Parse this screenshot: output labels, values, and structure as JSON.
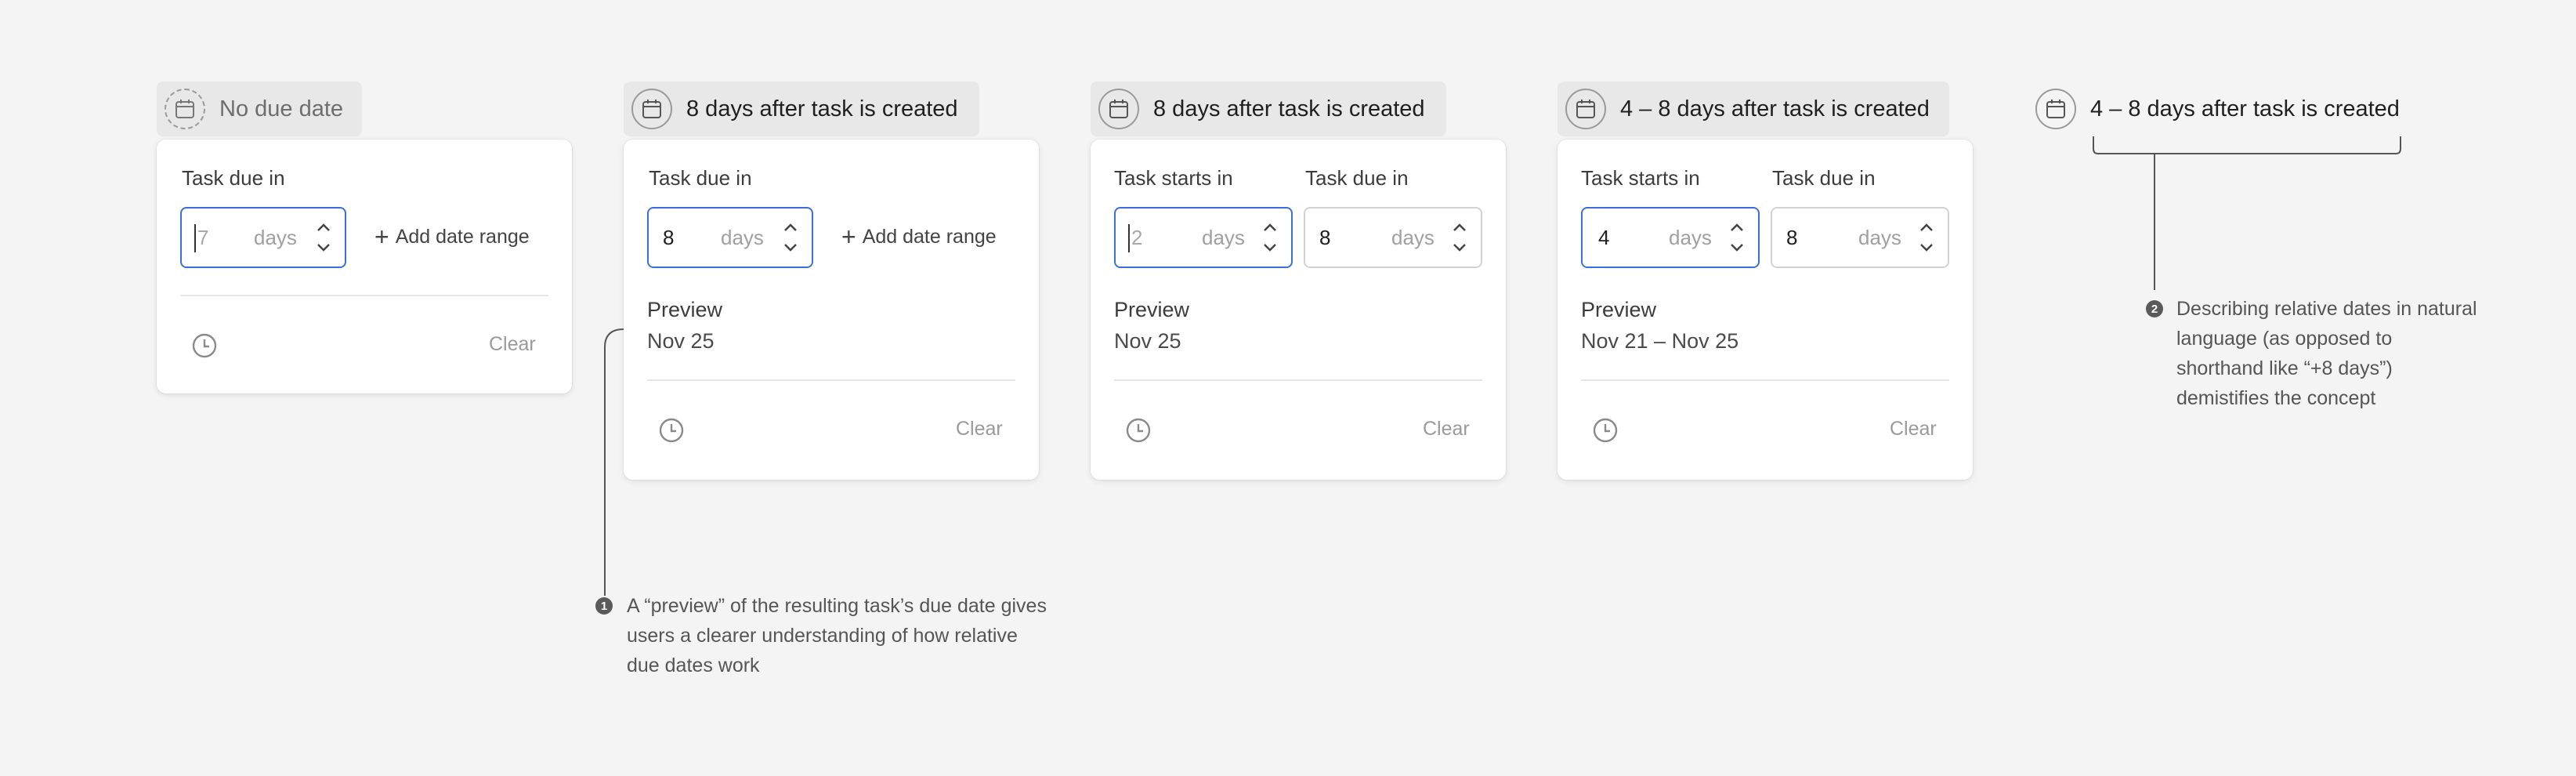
{
  "chips": [
    {
      "text": "No due date"
    },
    {
      "text": "8 days after task is created"
    },
    {
      "text": "8 days after task is created"
    },
    {
      "text": "4 – 8 days after task is created"
    },
    {
      "text": "4 – 8 days after task is created"
    }
  ],
  "card1": {
    "due_label": "Task due in",
    "due_value": "7",
    "unit": "days",
    "add_range": "Add date range",
    "clear": "Clear"
  },
  "card2": {
    "due_label": "Task due in",
    "due_value": "8",
    "unit": "days",
    "add_range": "Add date range",
    "preview_title": "Preview",
    "preview_date": "Nov 25",
    "clear": "Clear"
  },
  "card3": {
    "start_label": "Task starts in",
    "start_value": "2",
    "due_label": "Task due in",
    "due_value": "8",
    "unit": "days",
    "preview_title": "Preview",
    "preview_date": "Nov 25",
    "clear": "Clear"
  },
  "card4": {
    "start_label": "Task starts in",
    "start_value": "4",
    "due_label": "Task due in",
    "due_value": "8",
    "unit": "days",
    "preview_title": "Preview",
    "preview_date": "Nov 21 – Nov 25",
    "clear": "Clear"
  },
  "annotations": [
    {
      "num": "1",
      "text": "A “preview” of the resulting task’s due date gives users a clearer understanding of how relative due dates work"
    },
    {
      "num": "2",
      "text": "Describing relative dates in natural language (as opposed to shorthand like “+8 days”) demistifies the concept"
    }
  ],
  "colors": {
    "active_border": "#3c6fd6",
    "background": "#f4f4f4"
  },
  "icons": [
    "calendar-icon",
    "clock-icon",
    "plus-icon",
    "chevron-up-icon",
    "chevron-down-icon"
  ]
}
